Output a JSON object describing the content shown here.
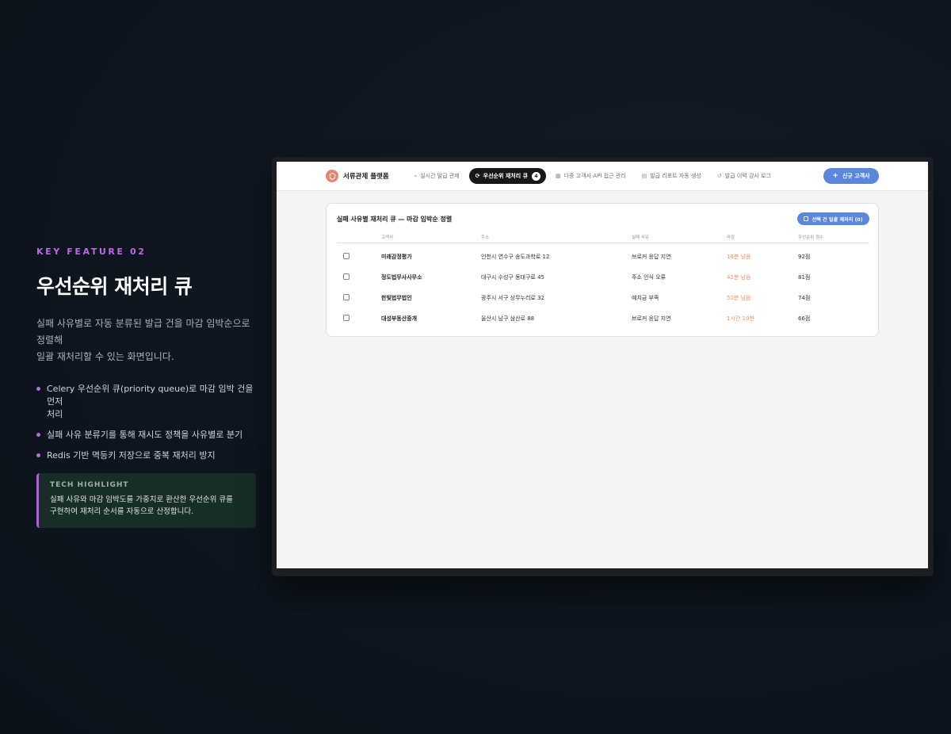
{
  "left": {
    "eyebrow": "KEY FEATURE 02",
    "headline": "우선순위 재처리 큐",
    "description_line1": "실패 사유별로 자동 분류된 발급 건을 마감 임박순으로 정렬해",
    "description_line2": "일괄 재처리할 수 있는 화면입니다.",
    "bullets": [
      {
        "line1": "Celery 우선순위 큐(priority queue)로 마감 임박 건을 먼저",
        "line2": "처리"
      },
      {
        "line1": "실패 사유 분류기를 통해 재시도 정책을 사유별로 분기",
        "line2": ""
      },
      {
        "line1": "Redis 기반 멱등키 저장으로 중복 재처리 방지",
        "line2": ""
      }
    ],
    "highlight": {
      "title": "TECH HIGHLIGHT",
      "line1": "실패 사유와 마감 임박도를 가중치로 환산한 우선순위 큐를",
      "line2": "구현하여 재처리 순서를 자동으로 산정합니다."
    }
  },
  "app": {
    "brand": "서류관제 플랫폼",
    "tabs": [
      {
        "label": "실시간 발급 관제",
        "icon": "pulse-icon"
      },
      {
        "label": "우선순위 재처리 큐",
        "icon": "refresh-icon",
        "count": "4",
        "active": true
      },
      {
        "label": "다중 고객사 API 접근 관리",
        "icon": "building-icon"
      },
      {
        "label": "발급 리포트 자동 생성",
        "icon": "document-icon"
      },
      {
        "label": "발급 이력 감사 로그",
        "icon": "history-icon"
      }
    ],
    "new_client_button": "신규 고객사",
    "card": {
      "title": "실패 사유별 재처리 큐 — 마감 임박순 정렬",
      "bulk_button": "선택 건 일괄 재처리 (0)",
      "columns": [
        "고객사",
        "주소",
        "실패 사유",
        "마감",
        "우선순위 점수"
      ],
      "rows": [
        {
          "name": "미래감정평가",
          "address": "인천시 연수구 송도과학로 12",
          "reason": "브로커 응답 지연",
          "deadline": "18분 남음",
          "score": "92점"
        },
        {
          "name": "정도법무사사무소",
          "address": "대구시 수성구 동대구로 45",
          "reason": "주소 인식 오류",
          "deadline": "41분 남음",
          "score": "81점"
        },
        {
          "name": "한빛법무법인",
          "address": "광주시 서구 상무누리로 32",
          "reason": "예치금 부족",
          "deadline": "52분 남음",
          "score": "74점"
        },
        {
          "name": "대성부동산중개",
          "address": "울산시 남구 삼산로 88",
          "reason": "브로커 응답 지연",
          "deadline": "1시간 10분",
          "score": "66점"
        }
      ]
    }
  },
  "colors": {
    "accent_purple": "#c266e8",
    "primary_blue": "#5a86dd",
    "deadline_orange": "#ef8d62",
    "highlight_bg": "#172d25"
  }
}
